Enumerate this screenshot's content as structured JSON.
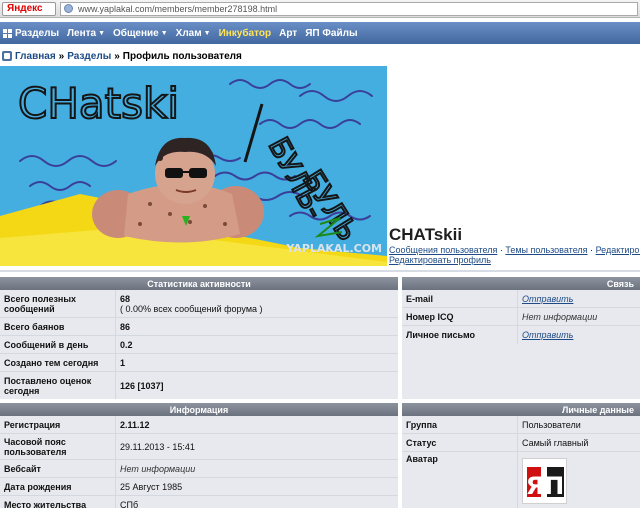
{
  "browser": {
    "yandex_label": "Яндекс",
    "url": "www.yaplakal.com/members/member278198.html"
  },
  "nav": {
    "items": [
      {
        "label": "Разделы",
        "caret": false,
        "highlight": false
      },
      {
        "label": "Лента",
        "caret": true,
        "highlight": false
      },
      {
        "label": "Общение",
        "caret": true,
        "highlight": false
      },
      {
        "label": "Хлам",
        "caret": true,
        "highlight": false
      },
      {
        "label": "Инкубатор",
        "caret": false,
        "highlight": true
      },
      {
        "label": "Арт",
        "caret": false,
        "highlight": false
      },
      {
        "label": "ЯП Файлы",
        "caret": false,
        "highlight": false
      }
    ],
    "caret_glyph": "▼",
    "highlight_color": "#ffe45a"
  },
  "breadcrumb": {
    "home": "Главная",
    "sections": "Разделы",
    "current": "Профиль пользователя",
    "separator": "»"
  },
  "avatar_drawing": {
    "text1": "CHatski",
    "text2": "БУЛЬ-",
    "text3": "БУЛЬ",
    "watermark": "YAPLAKAL.COM"
  },
  "profile": {
    "name": "CHATskii",
    "link_messages": "Сообщения пользователя",
    "link_topics": "Темы пользователя",
    "link_edit_cut": "Редактироват",
    "link_edit_profile": "Редактировать профиль",
    "dot": "·"
  },
  "stats": {
    "title": "Статистика активности",
    "rows": [
      {
        "label": "Всего полезных сообщений",
        "value": "68",
        "sub": "( 0.00% всех сообщений форума )"
      },
      {
        "label": "Всего баянов",
        "value": "86"
      },
      {
        "label": "Сообщений в день",
        "value": "0.2"
      },
      {
        "label": "Создано тем сегодня",
        "value": "1"
      },
      {
        "label": "Поставлено оценок сегодня",
        "value": "126 [1037]"
      }
    ]
  },
  "contact": {
    "title": "Связь",
    "rows": [
      {
        "label": "E-mail",
        "value": "Отправить"
      },
      {
        "label": "Номер ICQ",
        "value": "Нет информации"
      },
      {
        "label": "Личное письмо",
        "value": "Отправить"
      }
    ]
  },
  "info": {
    "title": "Информация",
    "rows": [
      {
        "label": "Регистрация",
        "value": "2.11.12"
      },
      {
        "label": "Часовой пояс пользователя",
        "value": "29.11.2013 - 15:41"
      },
      {
        "label": "Вебсайт",
        "value": "Нет информации"
      },
      {
        "label": "Дата рождения",
        "value": "25 Август 1985"
      },
      {
        "label": "Место жительства",
        "value": "СПб"
      }
    ]
  },
  "personal": {
    "title": "Личные данные",
    "rows": [
      {
        "label": "Группа",
        "value": "Пользователи"
      },
      {
        "label": "Статус",
        "value": "Самый главный"
      },
      {
        "label": "Аватар",
        "value": ""
      }
    ],
    "avatar_text": "ЯП"
  },
  "colors": {
    "nav_top": "#6a8fc7",
    "nav_bottom": "#42689f",
    "link": "#1e4b86",
    "panel_bg": "#e7e9ee",
    "header_bg": "#7b828d",
    "logo_red": "#d01010"
  }
}
